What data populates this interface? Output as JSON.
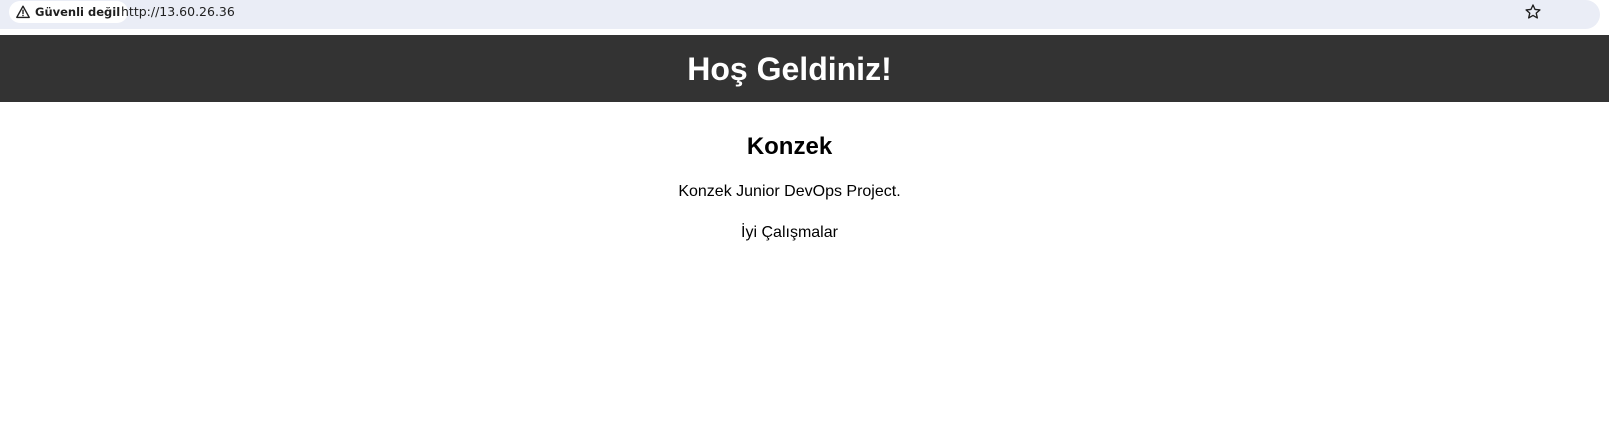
{
  "browser": {
    "security_label": "Güvenli değil",
    "url": "http://13.60.26.36",
    "security_icon": "warning-triangle-icon",
    "bookmark_icon": "star-icon"
  },
  "header": {
    "title": "Hoş Geldiniz!",
    "background": "#333333",
    "text_color": "#ffffff"
  },
  "main": {
    "heading": "Konzek",
    "description": "Konzek Junior DevOps Project.",
    "closing": "İyi Çalışmalar"
  }
}
